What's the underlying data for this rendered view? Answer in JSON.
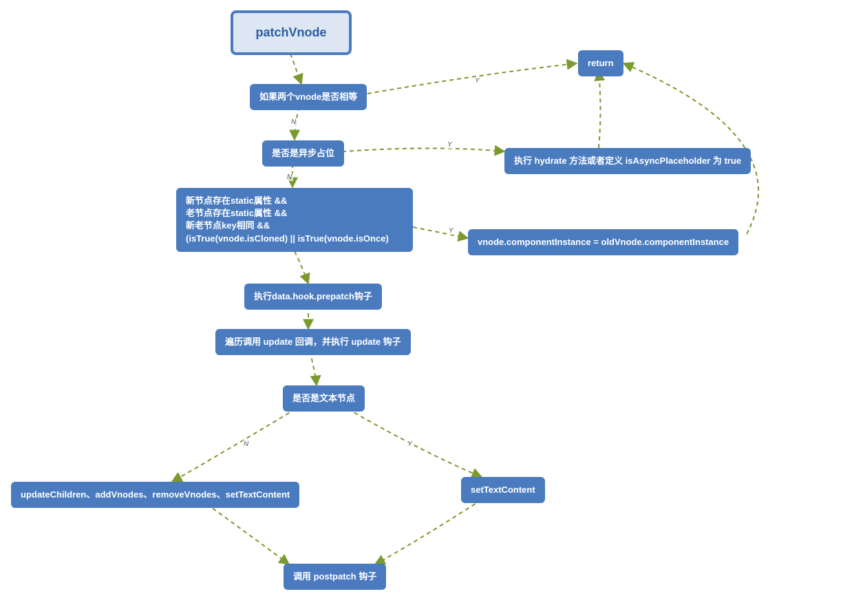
{
  "nodes": {
    "start": "patchVnode",
    "n1": "如果两个vnode是否相等",
    "n2": "是否是异步占位",
    "n3": "新节点存在static属性 &&\n老节点存在static属性 &&\n新老节点key相同 &&\n(isTrue(vnode.isCloned) || isTrue(vnode.isOnce)",
    "n4": "执行data.hook.prepatch钩子",
    "n5": "遍历调用 update 回调，并执行 update 钩子",
    "n6": "是否是文本节点",
    "n7": "updateChildren、addVnodes、removeVnodes、setTextContent",
    "n8": "setTextContent",
    "n9": "调用 postpatch 钩子",
    "ret": "return",
    "hydrate": "执行 hydrate 方法或者定义 isAsyncPlaceholder 为 true",
    "compInst": "vnode.componentInstance = oldVnode.componentInstance"
  },
  "labels": {
    "Y": "Y",
    "N": "N"
  },
  "chart_data": {
    "type": "flowchart",
    "title": "patchVnode",
    "nodes": [
      {
        "id": "start",
        "label": "patchVnode",
        "kind": "start"
      },
      {
        "id": "n1",
        "label": "如果两个vnode是否相等",
        "kind": "decision"
      },
      {
        "id": "n2",
        "label": "是否是异步占位",
        "kind": "decision"
      },
      {
        "id": "n3",
        "label": "新节点存在static属性 && 老节点存在static属性 && 新老节点key相同 && (isTrue(vnode.isCloned) || isTrue(vnode.isOnce)",
        "kind": "decision"
      },
      {
        "id": "n4",
        "label": "执行data.hook.prepatch钩子",
        "kind": "process"
      },
      {
        "id": "n5",
        "label": "遍历调用 update 回调，并执行 update 钩子",
        "kind": "process"
      },
      {
        "id": "n6",
        "label": "是否是文本节点",
        "kind": "decision"
      },
      {
        "id": "n7",
        "label": "updateChildren、addVnodes、removeVnodes、setTextContent",
        "kind": "process"
      },
      {
        "id": "n8",
        "label": "setTextContent",
        "kind": "process"
      },
      {
        "id": "n9",
        "label": "调用 postpatch 钩子",
        "kind": "process"
      },
      {
        "id": "ret",
        "label": "return",
        "kind": "terminal"
      },
      {
        "id": "hydrate",
        "label": "执行 hydrate 方法或者定义 isAsyncPlaceholder 为 true",
        "kind": "process"
      },
      {
        "id": "compInst",
        "label": "vnode.componentInstance = oldVnode.componentInstance",
        "kind": "process"
      }
    ],
    "edges": [
      {
        "from": "start",
        "to": "n1",
        "label": ""
      },
      {
        "from": "n1",
        "to": "ret",
        "label": "Y"
      },
      {
        "from": "n1",
        "to": "n2",
        "label": "N"
      },
      {
        "from": "n2",
        "to": "hydrate",
        "label": "Y"
      },
      {
        "from": "hydrate",
        "to": "ret",
        "label": ""
      },
      {
        "from": "n2",
        "to": "n3",
        "label": "N"
      },
      {
        "from": "n3",
        "to": "compInst",
        "label": "Y"
      },
      {
        "from": "compInst",
        "to": "ret",
        "label": ""
      },
      {
        "from": "n3",
        "to": "n4",
        "label": ""
      },
      {
        "from": "n4",
        "to": "n5",
        "label": ""
      },
      {
        "from": "n5",
        "to": "n6",
        "label": ""
      },
      {
        "from": "n6",
        "to": "n7",
        "label": "N"
      },
      {
        "from": "n6",
        "to": "n8",
        "label": "Y"
      },
      {
        "from": "n7",
        "to": "n9",
        "label": ""
      },
      {
        "from": "n8",
        "to": "n9",
        "label": ""
      }
    ]
  }
}
